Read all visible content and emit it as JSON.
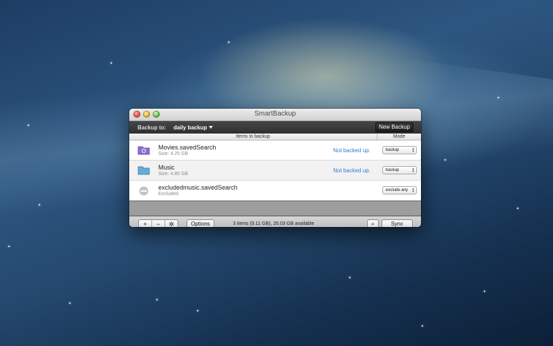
{
  "window": {
    "title": "SmartBackup"
  },
  "toolbar": {
    "backup_to_label": "Backup to:",
    "destination": "daily backup",
    "new_backup_label": "New Backup"
  },
  "columns": {
    "items": "Items to backup",
    "mode": "Mode"
  },
  "rows": [
    {
      "name": "Movies.savedSearch",
      "size": "Size: 4.25 GB",
      "status": "Not backed up.",
      "mode": "backup",
      "icon": "smart-folder-icon",
      "icon_color": "#8a6fcf"
    },
    {
      "name": "Music",
      "size": "Size: 4.85 GB",
      "status": "Not backed up.",
      "mode": "backup",
      "icon": "folder-icon",
      "icon_color": "#6aa9d8"
    },
    {
      "name": "excludedmusic.savedSearch",
      "size": "Excluded.",
      "status": "",
      "mode": "exclude any",
      "icon": "excluded-icon",
      "icon_color": "#bdbdbd"
    }
  ],
  "bottom": {
    "add": "+",
    "remove": "−",
    "settings": "✲",
    "options_label": "Options",
    "status": "3 items (9.11 GB), 26.03 GB available",
    "search": "⌕",
    "sync_label": "Sync"
  }
}
